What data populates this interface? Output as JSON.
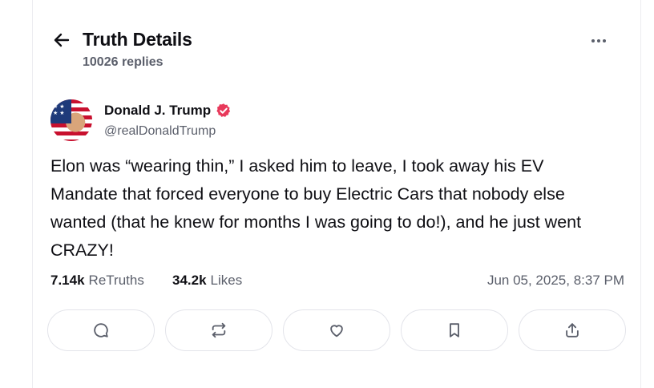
{
  "header": {
    "title": "Truth Details",
    "replies": "10026 replies"
  },
  "author": {
    "name": "Donald J. Trump",
    "handle": "@realDonaldTrump",
    "verified": true
  },
  "post": {
    "text": "Elon was “wearing thin,” I asked him to leave, I took away his EV Mandate that forced everyone to buy Electric Cars that nobody else wanted (that he knew for months I was going to do!), and he just went CRAZY!"
  },
  "stats": {
    "retruths_count": "7.14k",
    "retruths_label": "ReTruths",
    "likes_count": "34.2k",
    "likes_label": "Likes",
    "timestamp": "Jun 05, 2025, 8:37 PM"
  },
  "actions": [
    {
      "icon": "reply-icon"
    },
    {
      "icon": "retruth-icon"
    },
    {
      "icon": "heart-icon"
    },
    {
      "icon": "bookmark-icon"
    },
    {
      "icon": "share-icon"
    }
  ],
  "colors": {
    "verified_badge": "#e8395b",
    "muted_text": "#5b5f6b",
    "border": "#e3e4ea"
  }
}
